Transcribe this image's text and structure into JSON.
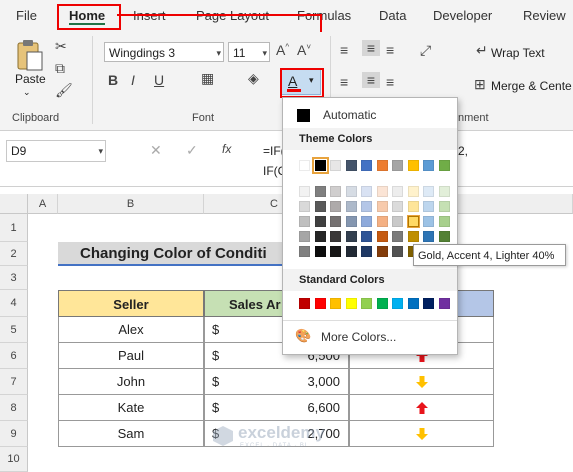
{
  "tabs": [
    "File",
    "Home",
    "Insert",
    "Page Layout",
    "Formulas",
    "Data",
    "Developer",
    "Review"
  ],
  "clipboard": {
    "paste_label": "Paste",
    "group_label": "Clipboard"
  },
  "font": {
    "name": "Wingdings 3",
    "size": "11",
    "group_label": "Font",
    "font_color_letter": "A"
  },
  "alignment": {
    "wrap_text": "Wrap Text",
    "merge_center": "Merge & Cente",
    "group_label_partial": "nment"
  },
  "formula_bar": {
    "name_box": "D9",
    "fx": "fx",
    "formula_line1": "=IF(",
    "formula_line2": "IF(C",
    "formula_tail": "2,"
  },
  "sheet": {
    "col_headers": [
      "A",
      "B",
      "C"
    ],
    "row_headers": [
      "1",
      "2",
      "3",
      "4",
      "5",
      "6",
      "7",
      "8",
      "9",
      "10"
    ],
    "title": "Changing Color of Conditi",
    "header_seller": "Seller",
    "header_sales": "Sales Ar",
    "rows": [
      {
        "seller": "Alex",
        "cur": "$",
        "amount": "",
        "arrow": ""
      },
      {
        "seller": "Paul",
        "cur": "$",
        "amount": "6,500",
        "arrow": "up"
      },
      {
        "seller": "John",
        "cur": "$",
        "amount": "3,000",
        "arrow": "down"
      },
      {
        "seller": "Kate",
        "cur": "$",
        "amount": "6,600",
        "arrow": "up"
      },
      {
        "seller": "Sam",
        "cur": "$",
        "amount": "2,700",
        "arrow": "down"
      }
    ],
    "arrow_colors": {
      "up": "#e8141b",
      "down": "#ffc000"
    }
  },
  "color_menu": {
    "automatic": "Automatic",
    "theme_title": "Theme Colors",
    "standard_title": "Standard Colors",
    "more_colors": "More Colors...",
    "theme_top": [
      "#ffffff",
      "#000000",
      "#e7e6e6",
      "#44546a",
      "#4472c4",
      "#ed7d31",
      "#a5a5a5",
      "#ffc000",
      "#5b9bd5",
      "#70ad47"
    ],
    "theme_shades": [
      [
        "#f2f2f2",
        "#d9d9d9",
        "#bfbfbf",
        "#a6a6a6",
        "#808080"
      ],
      [
        "#7f7f7f",
        "#595959",
        "#404040",
        "#262626",
        "#0d0d0d"
      ],
      [
        "#d0cece",
        "#aeaaaa",
        "#757171",
        "#3a3838",
        "#171616"
      ],
      [
        "#d6dce4",
        "#adb9ca",
        "#8496b0",
        "#333f4f",
        "#222a35"
      ],
      [
        "#d9e2f3",
        "#b4c6e7",
        "#8eaadb",
        "#2f5496",
        "#1f3864"
      ],
      [
        "#fbe4d5",
        "#f7caac",
        "#f4b083",
        "#c55a11",
        "#833c0b"
      ],
      [
        "#ededed",
        "#dbdbdb",
        "#c9c9c9",
        "#7b7b7b",
        "#525252"
      ],
      [
        "#fff2cc",
        "#fee599",
        "#ffd965",
        "#bf8f00",
        "#7f6000"
      ],
      [
        "#deeaf6",
        "#bdd6ee",
        "#9cc2e5",
        "#2e75b5",
        "#1f4e79"
      ],
      [
        "#e2efd9",
        "#c5e0b3",
        "#a8d08d",
        "#538135",
        "#375623"
      ]
    ],
    "standard": [
      "#c00000",
      "#ff0000",
      "#ffc000",
      "#ffff00",
      "#92d050",
      "#00b050",
      "#00b0f0",
      "#0070c0",
      "#002060",
      "#7030a0"
    ]
  },
  "tooltip": "Gold, Accent 4, Lighter 40%",
  "watermark": {
    "name": "exceldemy",
    "tagline": "EXCEL · DATA · BI"
  }
}
